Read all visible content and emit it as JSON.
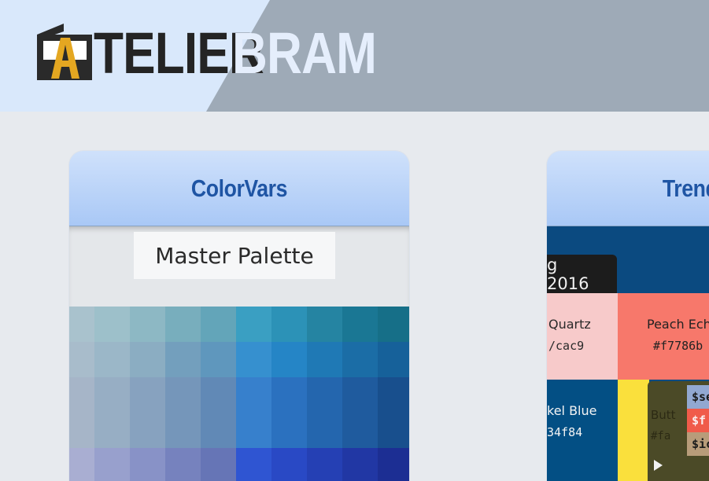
{
  "brand": {
    "logo_letter": "A",
    "word_dark": "TELIER",
    "word_light": "BRAM"
  },
  "cards": [
    {
      "title": "ColorVars",
      "subtitle": "Master Palette",
      "palette_rows": [
        [
          "#a9c2cd",
          "#9dc0ca",
          "#8db8c4",
          "#78aebd",
          "#63a5b9",
          "#3a9fc2",
          "#2c92b7",
          "#2584a2",
          "#1a7794",
          "#166f88"
        ],
        [
          "#a8bccb",
          "#9bb7c8",
          "#8badc2",
          "#739fbd",
          "#5f97bd",
          "#3690cf",
          "#2585c6",
          "#1f79b5",
          "#1b6da6",
          "#16619a"
        ],
        [
          "#a6b5c8",
          "#97aec4",
          "#87a2bf",
          "#7596ba",
          "#6189b6",
          "#3780cc",
          "#2b71bf",
          "#2466ae",
          "#1f5b9e",
          "#184f8d"
        ],
        [
          "#a9aed2",
          "#98a0cd",
          "#8892c7",
          "#7682be",
          "#6675b6",
          "#2f55d2",
          "#2949c5",
          "#2540b4",
          "#2137a4",
          "#1c2e93"
        ]
      ]
    },
    {
      "title": "Trends",
      "tab_label": "g 2016",
      "swatches": [
        {
          "name": "Quartz",
          "hex": "/cac9"
        },
        {
          "name": "Peach Echo",
          "hex": "#f7786b"
        },
        {
          "name": "kel Blue",
          "hex": "34f84"
        }
      ],
      "code_panel": {
        "label": "Butt",
        "label_hex": "#fa",
        "lines": [
          "$se",
          "$f",
          "$ic"
        ]
      }
    }
  ]
}
